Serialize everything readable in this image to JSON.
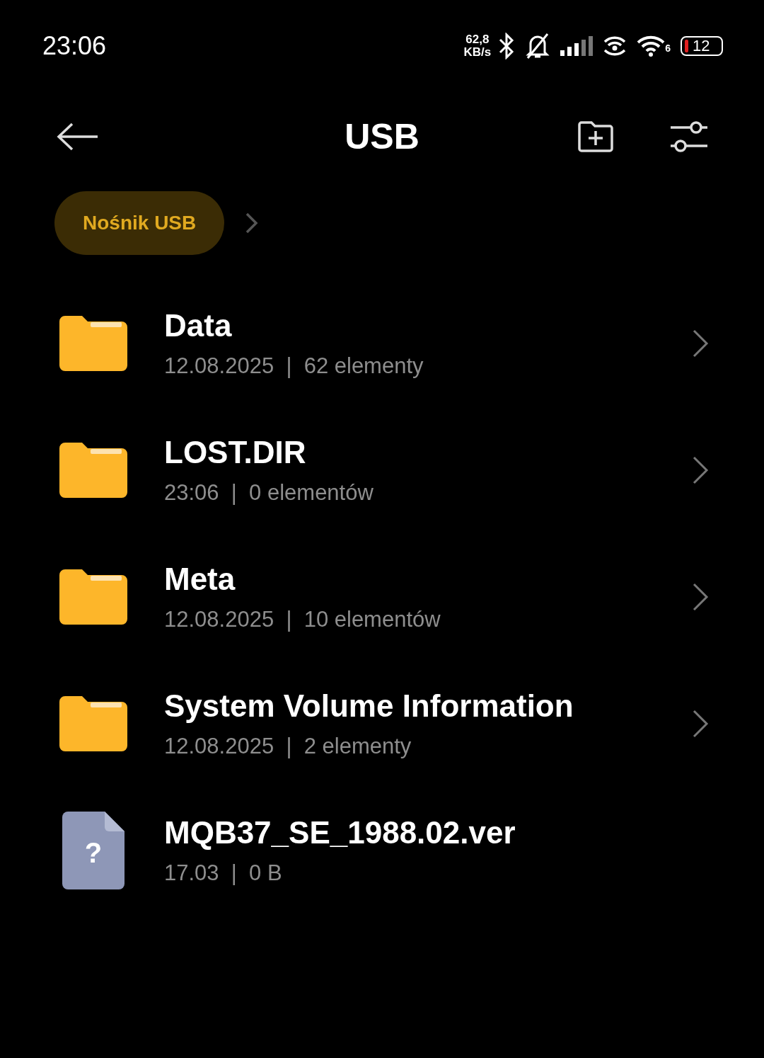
{
  "status_bar": {
    "time": "23:06",
    "net_speed": "62,8",
    "net_unit": "KB/s",
    "wifi_badge": "6",
    "battery": "12"
  },
  "header": {
    "title": "USB"
  },
  "breadcrumb": [
    {
      "label": "Nośnik USB",
      "selected": true
    }
  ],
  "items": [
    {
      "kind": "folder",
      "name": "Data",
      "details": "12.08.2025  |  62 elementy"
    },
    {
      "kind": "folder",
      "name": "LOST.DIR",
      "details": "23:06  |  0 elementów"
    },
    {
      "kind": "folder",
      "name": "Meta",
      "details": "12.08.2025  |  10 elementów"
    },
    {
      "kind": "folder",
      "name": "System Volume Information",
      "details": "12.08.2025  |  2 elementy"
    },
    {
      "kind": "file",
      "name": "MQB37_SE_1988.02.ver",
      "details": "17.03  |  0 B",
      "glyph": "?"
    }
  ]
}
